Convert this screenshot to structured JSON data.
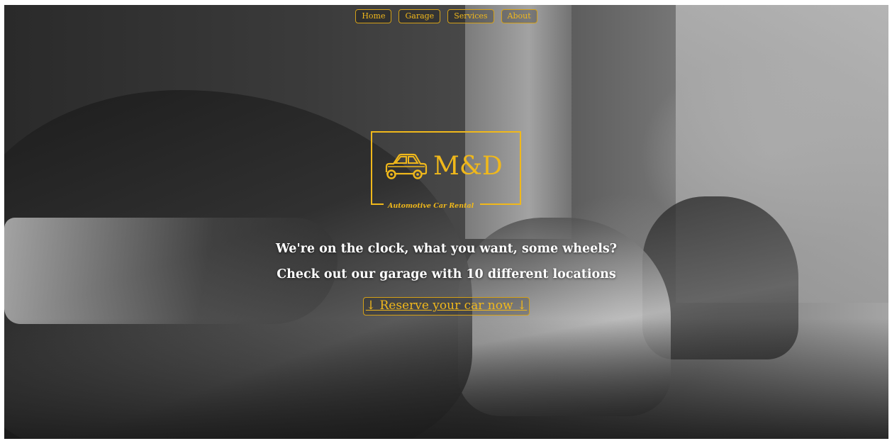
{
  "nav": {
    "items": [
      {
        "label": "Home"
      },
      {
        "label": "Garage"
      },
      {
        "label": "Services"
      },
      {
        "label": "About"
      }
    ]
  },
  "logo": {
    "name": "M&D",
    "tagline": "Automotive Car Rental",
    "icon": "car-icon"
  },
  "hero": {
    "headline_1": "We're on the clock, what you want, some wheels?",
    "headline_2": "Check out our garage with 10 different locations",
    "cta_label": "↓ Reserve your car now ↓"
  },
  "colors": {
    "accent": "#f0b81b",
    "text": "#ffffff"
  }
}
